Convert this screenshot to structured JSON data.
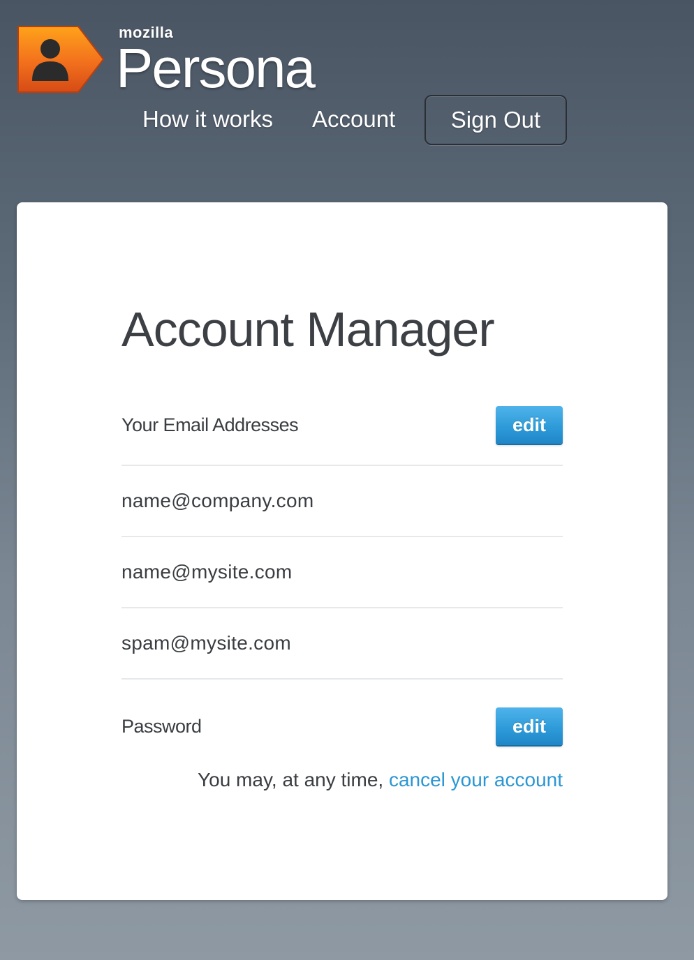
{
  "brand": {
    "small": "mozilla",
    "big": "Persona",
    "icon": "persona-logo-icon",
    "colors": {
      "logo_orange": "#f06a1d",
      "accent_blue": "#2b96d3"
    }
  },
  "nav": {
    "how_it_works": "How it works",
    "account": "Account",
    "sign_out": "Sign Out"
  },
  "main": {
    "title": "Account Manager",
    "emails_label": "Your Email Addresses",
    "emails_edit": "edit",
    "emails": [
      "name@company.com",
      "name@mysite.com",
      "spam@mysite.com"
    ],
    "password_label": "Password",
    "password_edit": "edit",
    "cancel_prefix": "You may, at any time, ",
    "cancel_link": "cancel your account"
  }
}
